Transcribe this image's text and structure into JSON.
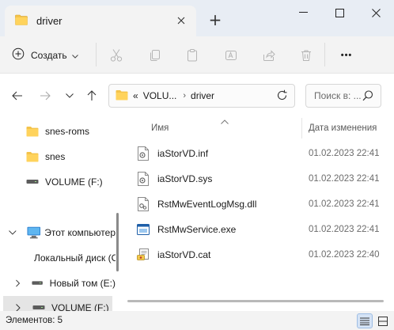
{
  "window": {
    "tab_title": "driver",
    "new_tab_symbol": "+"
  },
  "toolbar": {
    "create_label": "Создать",
    "more_label": "•••"
  },
  "addressbar": {
    "overflow": "«",
    "segments": [
      "VOLU...",
      "driver"
    ],
    "search_placeholder": "Поиск в: ..."
  },
  "sidebar": {
    "items": [
      {
        "label": "snes-roms",
        "icon": "folder-icon"
      },
      {
        "label": "snes",
        "icon": "folder-icon"
      },
      {
        "label": "VOLUME (F:)",
        "icon": "drive-icon"
      },
      {
        "label": "Этот компьютер",
        "icon": "computer-icon"
      },
      {
        "label": "Локальный диск (C:)",
        "icon": "windows-drive-icon"
      },
      {
        "label": "Новый том (E:)",
        "icon": "drive-icon"
      },
      {
        "label": "VOLUME (F:)",
        "icon": "drive-icon"
      }
    ]
  },
  "columns": {
    "name": "Имя",
    "date": "Дата изменения"
  },
  "files": [
    {
      "name": "iaStorVD.inf",
      "date": "01.02.2023 22:41",
      "icon": "inf-file-icon"
    },
    {
      "name": "iaStorVD.sys",
      "date": "01.02.2023 22:41",
      "icon": "sys-file-icon"
    },
    {
      "name": "RstMwEventLogMsg.dll",
      "date": "01.02.2023 22:41",
      "icon": "dll-file-icon"
    },
    {
      "name": "RstMwService.exe",
      "date": "01.02.2023 22:41",
      "icon": "exe-file-icon"
    },
    {
      "name": "iaStorVD.cat",
      "date": "01.02.2023 22:40",
      "icon": "cat-file-icon"
    }
  ],
  "status": {
    "count": "Элементов: 5"
  },
  "colors": {
    "accent": "#0067c0",
    "folder": "#f4c34a",
    "titlebar": "#e8edf4",
    "selection": "#e5e5e5"
  }
}
